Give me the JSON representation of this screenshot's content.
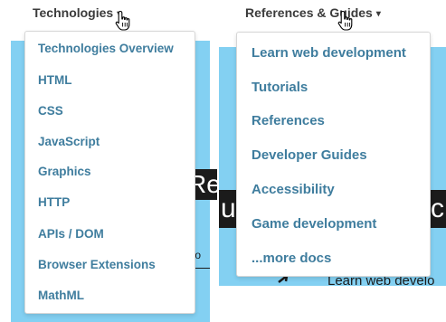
{
  "background": {
    "left_heading_fragment": "Re",
    "left_text_fragment": "olo",
    "right_heading_left_fragment": "u",
    "right_heading_right_fragment": "c",
    "right_text_fragment": "Learn web develo"
  },
  "nav": {
    "technologies": {
      "label": "Technologies",
      "caret": "▾",
      "items": [
        "Technologies Overview",
        "HTML",
        "CSS",
        "JavaScript",
        "Graphics",
        "HTTP",
        "APIs / DOM",
        "Browser Extensions",
        "MathML"
      ]
    },
    "references": {
      "label": "References & Guides",
      "caret": "▾",
      "items": [
        "Learn web development",
        "Tutorials",
        "References",
        "Developer Guides",
        "Accessibility",
        "Game development",
        "...more docs"
      ]
    }
  },
  "colors": {
    "link": "#3f7d9e",
    "nav_text": "#3b3b3b",
    "background_blue": "#83d0f2",
    "dark_band": "#1b1b1b"
  }
}
